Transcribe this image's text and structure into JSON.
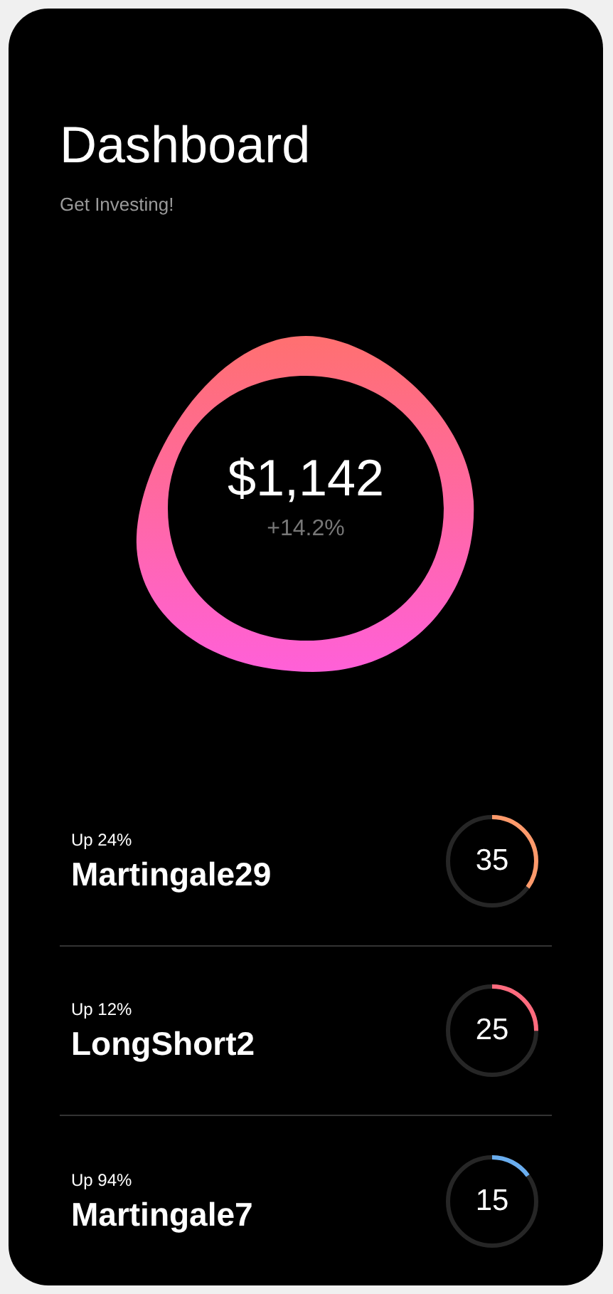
{
  "header": {
    "title": "Dashboard",
    "subtitle": "Get Investing!"
  },
  "balance": {
    "amount": "$1,142",
    "change": "+14.2%"
  },
  "strategies": [
    {
      "caption": "Up 24%",
      "name": "Martingale29",
      "value": "35",
      "level": 0.35,
      "color": "#ff9a6b"
    },
    {
      "caption": "Up 12%",
      "name": "LongShort2",
      "value": "25",
      "level": 0.25,
      "color": "#ff6b7e"
    },
    {
      "caption": "Up 94%",
      "name": "Martingale7",
      "value": "15",
      "level": 0.15,
      "color": "#6aaef0"
    }
  ]
}
